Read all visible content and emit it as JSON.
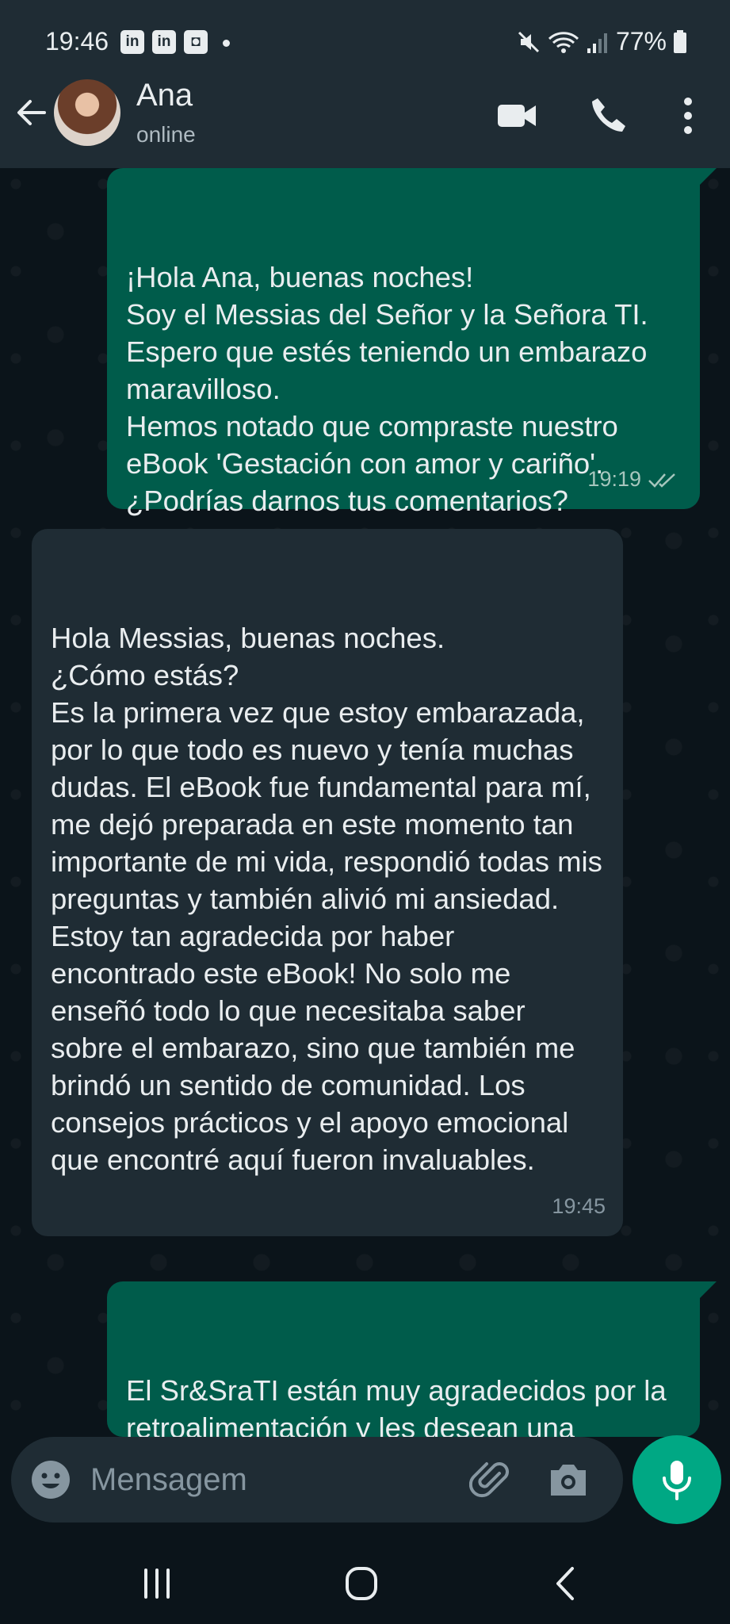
{
  "status_bar": {
    "time": "19:46",
    "notif_icons": [
      "linkedin-icon",
      "linkedin-icon",
      "app-notification-icon"
    ],
    "right_icons": [
      "mute-icon",
      "wifi-icon",
      "signal-icon"
    ],
    "battery": "77%"
  },
  "header": {
    "contact_name": "Ana",
    "contact_status": "online",
    "icons": [
      "back-arrow-icon",
      "video-call-icon",
      "voice-call-icon",
      "more-options-icon"
    ]
  },
  "messages": [
    {
      "direction": "outgoing",
      "text": "¡Hola Ana, buenas noches!\nSoy el Messias del Señor y la Señora TI. Espero que estés teniendo un embarazo maravilloso.\nHemos notado que compraste nuestro eBook 'Gestación con amor y cariño'. ¿Podrías darnos tus comentarios?",
      "time": "19:19",
      "status": "read"
    },
    {
      "direction": "incoming",
      "text": "Hola Messias, buenas noches.\n¿Cómo estás?\nEs la primera vez que estoy embarazada, por lo que todo es nuevo y tenía muchas dudas. El eBook fue fundamental para mí, me dejó preparada en este momento tan importante de mi vida, respondió todas mis preguntas y también alivió mi ansiedad.\nEstoy tan agradecida por haber encontrado este eBook! No solo me enseñó todo lo que necesitaba saber sobre el embarazo, sino que también me brindó un sentido de comunidad. Los consejos prácticos y el apoyo emocional que encontré aquí fueron invaluables.",
      "time": "19:45"
    },
    {
      "direction": "outgoing",
      "text": "El Sr&SraTI están muy agradecidos por la retroalimentación y les desean una inmensa felicidad a ustedes."
    }
  ],
  "composer": {
    "placeholder": "Mensagem",
    "value": ""
  },
  "colors": {
    "outgoing_bubble": "#005c4b",
    "incoming_bubble": "#1f2c34",
    "accent": "#00a884",
    "background": "#0b141a"
  }
}
